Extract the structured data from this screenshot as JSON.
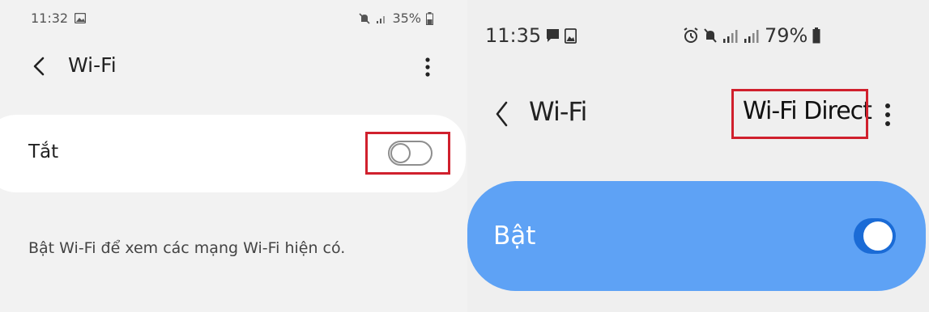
{
  "left_screen": {
    "status_bar": {
      "time": "11:32",
      "battery": "35%",
      "icons": [
        "gallery-icon",
        "mute-icon",
        "signal-icon",
        "battery-icon"
      ]
    },
    "header": {
      "back_icon": "back-arrow-icon",
      "title": "Wi-Fi",
      "more_icon": "more-options-icon"
    },
    "wifi_toggle": {
      "label": "Tắt",
      "state": "off"
    },
    "hint": "Bật Wi-Fi để xem các mạng Wi-Fi hiện có."
  },
  "right_screen": {
    "status_bar": {
      "time": "11:35",
      "battery": "79%",
      "icons": [
        "message-icon",
        "gallery-icon",
        "alarm-icon",
        "mute-icon",
        "signal-icon",
        "signal-icon",
        "battery-icon"
      ]
    },
    "header": {
      "back_icon": "back-arrow-icon",
      "title": "Wi-Fi",
      "direct_label": "Wi-Fi Direct",
      "more_icon": "more-options-icon"
    },
    "wifi_toggle": {
      "label": "Bật",
      "state": "on"
    }
  },
  "colors": {
    "highlight": "#d0202d",
    "toggle_on_card": "#5ea2f5",
    "toggle_on_switch": "#1a6bd6"
  }
}
